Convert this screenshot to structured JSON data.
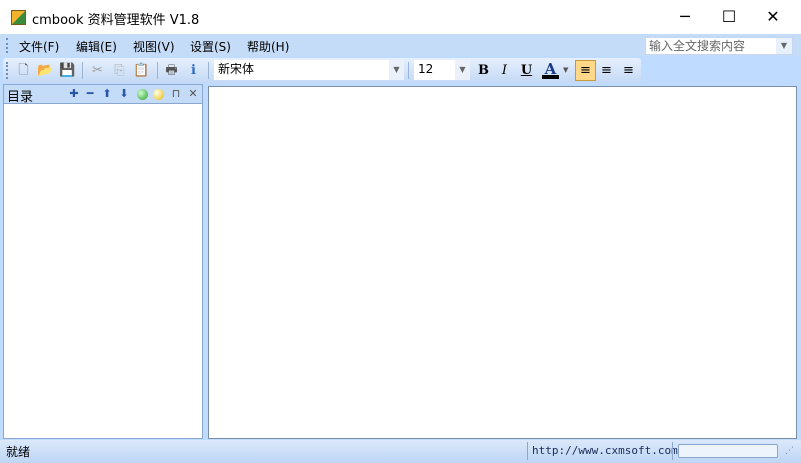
{
  "window": {
    "title": "cmbook 资料管理软件 V1.8",
    "minimize": "─",
    "maximize": "☐",
    "close": "✕"
  },
  "menu": [
    "文件(F)",
    "编辑(E)",
    "视图(V)",
    "设置(S)",
    "帮助(H)"
  ],
  "search": {
    "placeholder": "输入全文搜索内容"
  },
  "toolbar": {
    "font": "新宋体",
    "size": "12",
    "bold": "B",
    "italic": "I",
    "underline": "U",
    "color_letter": "A",
    "font_color": "#000000",
    "active_align": "left"
  },
  "panel": {
    "title": "目录"
  },
  "status": {
    "text": "就绪",
    "url": "http://www.cxmsoft.com",
    "progress": 0
  }
}
